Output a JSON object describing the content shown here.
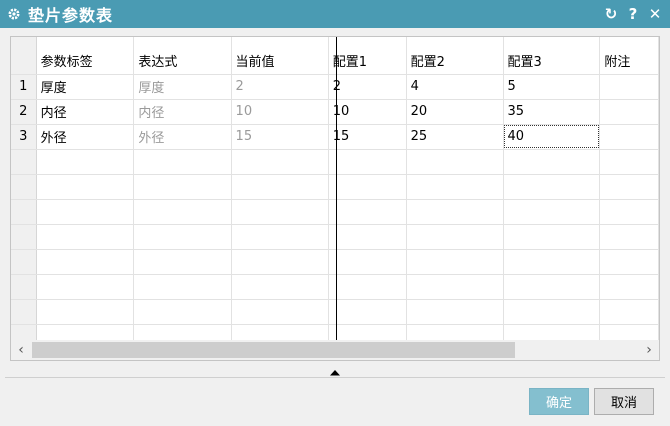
{
  "window": {
    "title": "垫片参数表",
    "icons": {
      "app": "gear-icon",
      "refresh": "refresh-icon",
      "help": "help-icon",
      "close": "close-icon"
    },
    "help_glyph": "?",
    "close_glyph": "✕",
    "refresh_glyph": "↻",
    "accent_color": "#4a9bb3"
  },
  "grid": {
    "columns": [
      "参数标签",
      "表达式",
      "当前值",
      "配置1",
      "配置2",
      "配置3",
      "附注"
    ],
    "rows": [
      {
        "num": "1",
        "label": "厚度",
        "expr": "厚度",
        "current": "2",
        "c1": "2",
        "c2": "4",
        "c3": "5",
        "note": ""
      },
      {
        "num": "2",
        "label": "内径",
        "expr": "内径",
        "current": "10",
        "c1": "10",
        "c2": "20",
        "c3": "35",
        "note": ""
      },
      {
        "num": "3",
        "label": "外径",
        "expr": "外径",
        "current": "15",
        "c1": "15",
        "c2": "25",
        "c3": "40",
        "note": ""
      }
    ],
    "scroll_left_glyph": "‹",
    "scroll_right_glyph": "›"
  },
  "footer": {
    "ok_label": "确定",
    "cancel_label": "取消"
  }
}
